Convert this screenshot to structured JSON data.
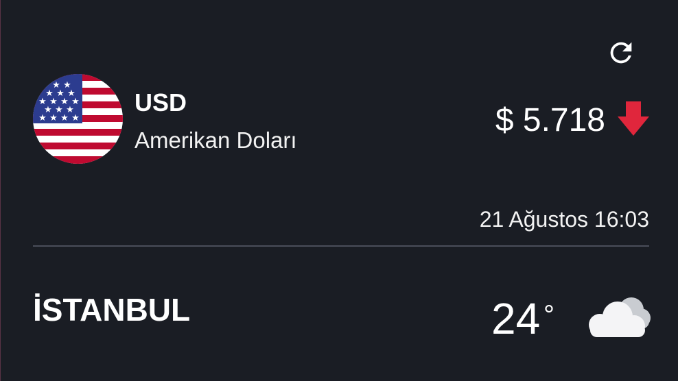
{
  "header": {
    "refresh_icon": "refresh-icon"
  },
  "currency": {
    "flag_icon": "us-flag-icon",
    "code": "USD",
    "name": "Amerikan Doları",
    "rate": "$ 5.718",
    "trend_icon": "arrow-down-icon",
    "trend_color": "#e0263c",
    "updated": "21 Ağustos 16:03"
  },
  "weather": {
    "city": "İSTANBUL",
    "temperature": "24",
    "degree_symbol": "°",
    "condition_icon": "cloud-icon"
  },
  "colors": {
    "background": "#1a1d24",
    "divider": "#4a4e5a",
    "text": "#ffffff"
  }
}
